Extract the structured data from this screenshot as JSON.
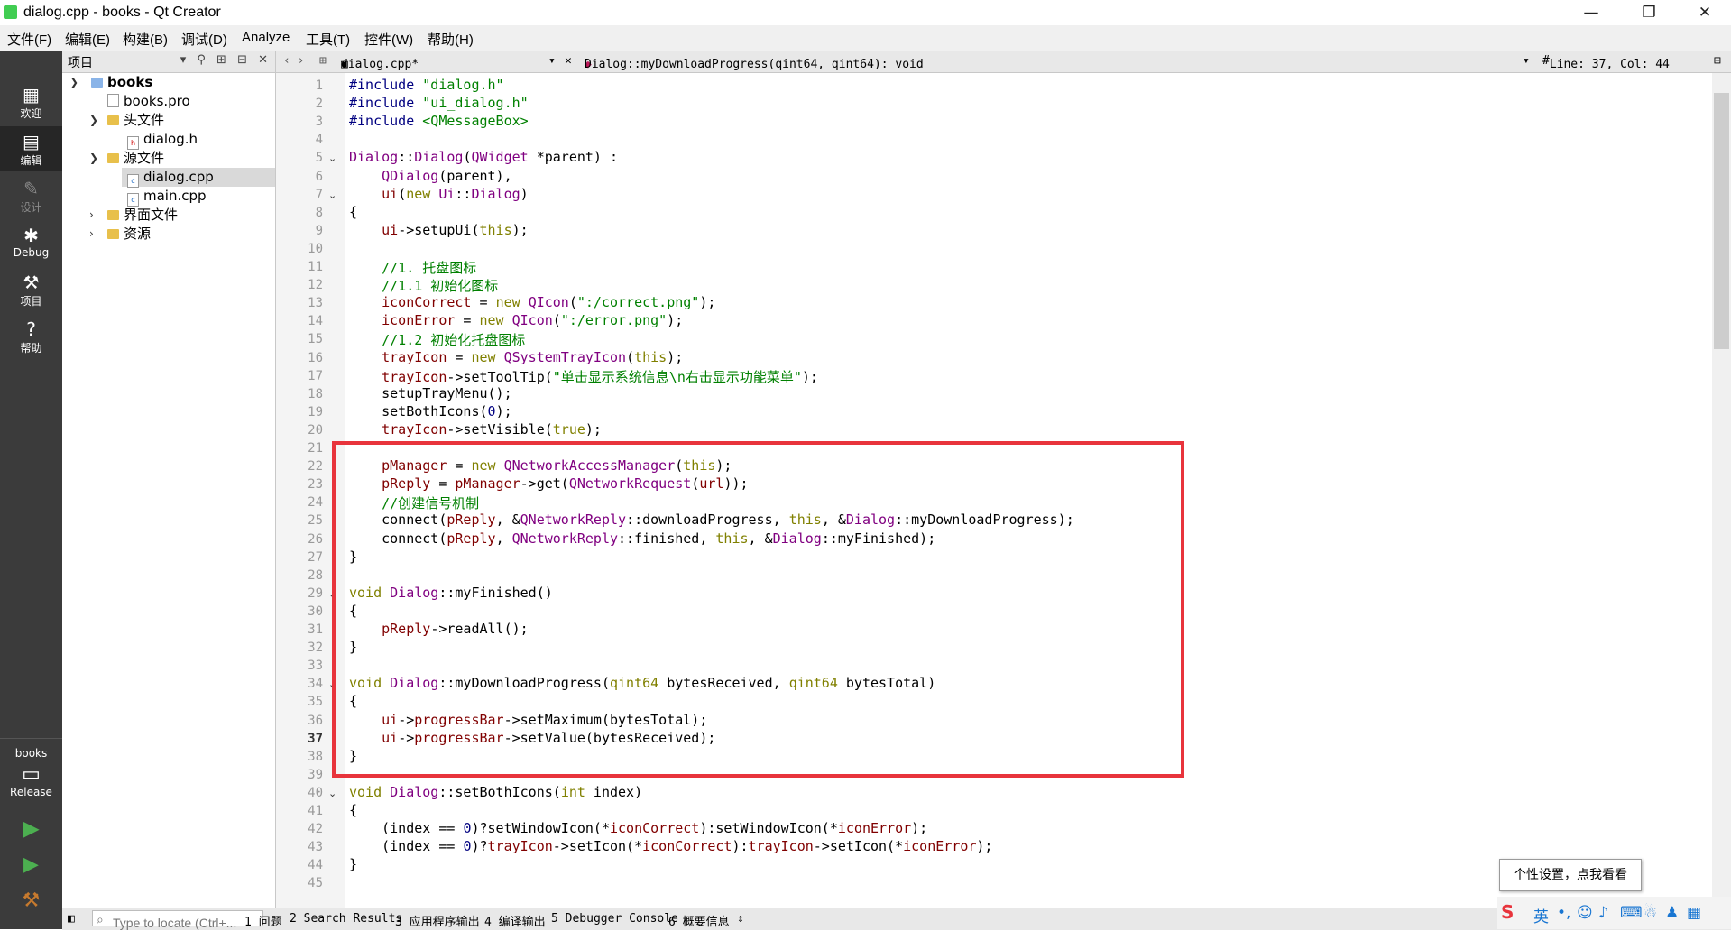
{
  "window": {
    "title": "dialog.cpp - books - Qt Creator",
    "minimize": "—",
    "maximize": "❐",
    "close": "✕"
  },
  "menu": [
    "文件(F)",
    "编辑(E)",
    "构建(B)",
    "调试(D)",
    "Analyze",
    "工具(T)",
    "控件(W)",
    "帮助(H)"
  ],
  "modes": [
    {
      "label": "欢迎",
      "icon": "grid-icon"
    },
    {
      "label": "编辑",
      "icon": "edit-icon"
    },
    {
      "label": "设计",
      "icon": "pencil-icon"
    },
    {
      "label": "Debug",
      "icon": "bug-icon"
    },
    {
      "label": "项目",
      "icon": "wrench-icon"
    },
    {
      "label": "帮助",
      "icon": "help-icon"
    }
  ],
  "target": {
    "project": "books",
    "config": "Release"
  },
  "project_panel": {
    "header": "项目",
    "tree": [
      {
        "label": "books",
        "level": 0,
        "expanded": true,
        "type": "project",
        "bold": true
      },
      {
        "label": "books.pro",
        "level": 1,
        "type": "file"
      },
      {
        "label": "头文件",
        "level": 1,
        "expanded": true,
        "type": "folder"
      },
      {
        "label": "dialog.h",
        "level": 2,
        "type": "file-h"
      },
      {
        "label": "源文件",
        "level": 1,
        "expanded": true,
        "type": "folder"
      },
      {
        "label": "dialog.cpp",
        "level": 2,
        "type": "file-cpp",
        "selected": true
      },
      {
        "label": "main.cpp",
        "level": 2,
        "type": "file-cpp"
      },
      {
        "label": "界面文件",
        "level": 1,
        "expanded": false,
        "type": "folder"
      },
      {
        "label": "资源",
        "level": 1,
        "expanded": false,
        "type": "folder"
      }
    ]
  },
  "editor_bar": {
    "file": "dialog.cpp*",
    "symbol": "Dialog::myDownloadProgress(qint64, qint64): void",
    "position": "Line: 37, Col: 44"
  },
  "code": {
    "current_line": 37,
    "lines": [
      "#include \"dialog.h\"",
      "#include \"ui_dialog.h\"",
      "#include <QMessageBox>",
      "",
      "Dialog::Dialog(QWidget *parent) :",
      "    QDialog(parent),",
      "    ui(new Ui::Dialog)",
      "{",
      "    ui->setupUi(this);",
      "",
      "    //1. 托盘图标",
      "    //1.1 初始化图标",
      "    iconCorrect = new QIcon(\":/correct.png\");",
      "    iconError = new QIcon(\":/error.png\");",
      "    //1.2 初始化托盘图标",
      "    trayIcon = new QSystemTrayIcon(this);",
      "    trayIcon->setToolTip(\"单击显示系统信息\\n右击显示功能菜单\");",
      "    setupTrayMenu();",
      "    setBothIcons(0);",
      "    trayIcon->setVisible(true);",
      "",
      "    pManager = new QNetworkAccessManager(this);",
      "    pReply = pManager->get(QNetworkRequest(url));",
      "    //创建信号机制",
      "    connect(pReply, &QNetworkReply::downloadProgress, this, &Dialog::myDownloadProgress);",
      "    connect(pReply, QNetworkReply::finished, this, &Dialog::myFinished);",
      "}",
      "",
      "void Dialog::myFinished()",
      "{",
      "    pReply->readAll();",
      "}",
      "",
      "void Dialog::myDownloadProgress(qint64 bytesReceived, qint64 bytesTotal)",
      "{",
      "    ui->progressBar->setMaximum(bytesTotal);",
      "    ui->progressBar->setValue(bytesReceived);",
      "}",
      "",
      "void Dialog::setBothIcons(int index)",
      "{",
      "    (index == 0)?setWindowIcon(*iconCorrect):setWindowIcon(*iconError);",
      "    (index == 0)?trayIcon->setIcon(*iconCorrect):trayIcon->setIcon(*iconError);",
      "}",
      ""
    ]
  },
  "status": {
    "locate_placeholder": "Type to locate (Ctrl+...",
    "tabs": [
      "1 问题",
      "2 Search Results",
      "3 应用程序输出",
      "4 编译输出",
      "5 Debugger Console",
      "6 概要信息"
    ]
  },
  "ime": {
    "tooltip": "个性设置，点我看看",
    "lang": "英"
  },
  "colors": {
    "highlight_box": "#e8343c",
    "mode_bar": "#3b3b3b"
  }
}
